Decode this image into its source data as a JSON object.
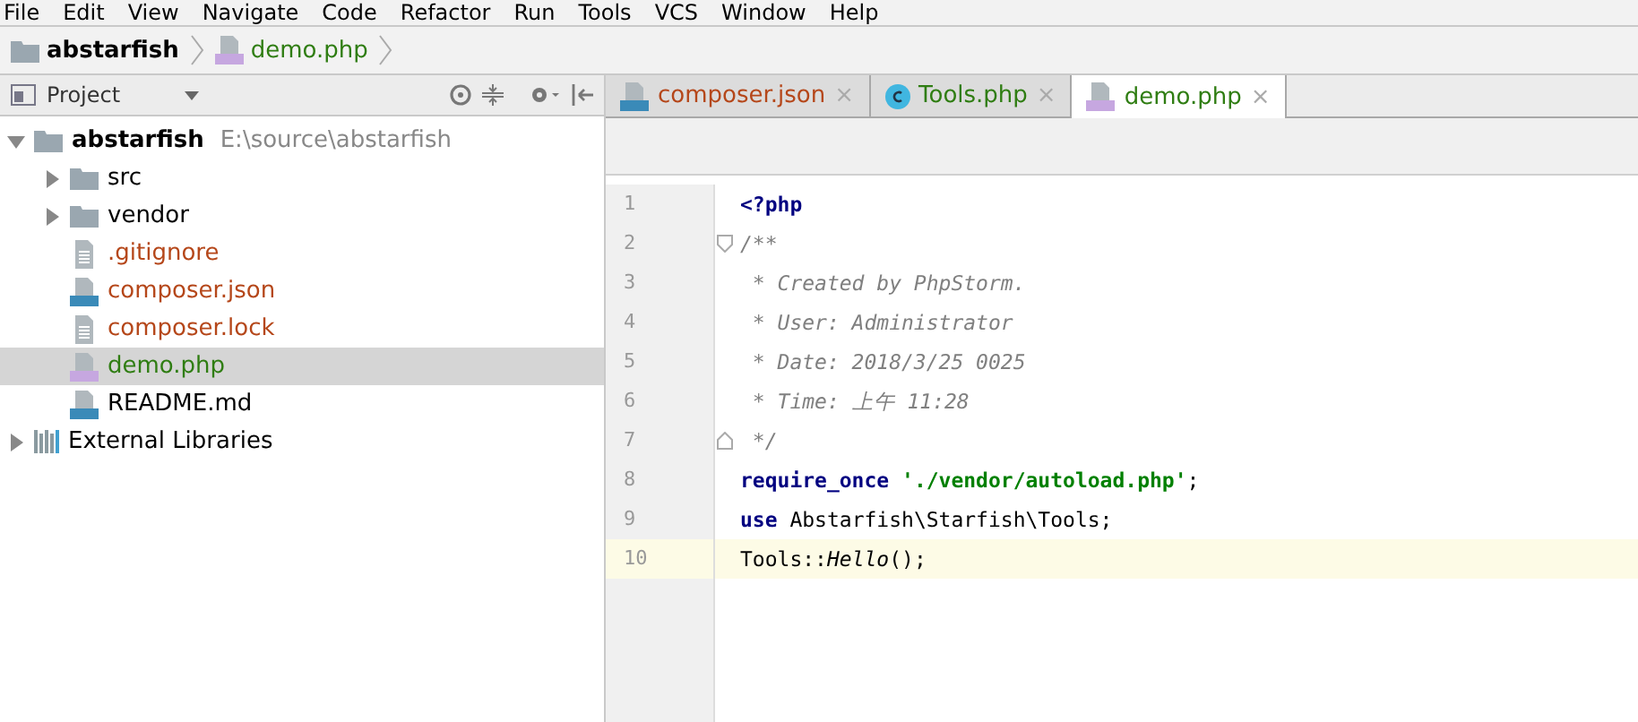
{
  "menu": [
    "File",
    "Edit",
    "View",
    "Navigate",
    "Code",
    "Refactor",
    "Run",
    "Tools",
    "VCS",
    "Window",
    "Help"
  ],
  "breadcrumb": [
    {
      "kind": "folder",
      "label": "abstarfish",
      "color": "#000000"
    },
    {
      "kind": "php",
      "label": "demo.php",
      "color": "#2f7d12"
    }
  ],
  "project_panel": {
    "title": "Project"
  },
  "tree": [
    {
      "kind": "folder",
      "label": "abstarfish",
      "hint": "E:\\source\\abstarfish",
      "expanded": true,
      "selected": false,
      "color": "#000000",
      "children": [
        {
          "kind": "folder",
          "label": "src",
          "expanded": false,
          "selected": false,
          "color": "#000000"
        },
        {
          "kind": "folder",
          "label": "vendor",
          "expanded": false,
          "selected": false,
          "color": "#000000"
        },
        {
          "kind": "text",
          "label": ".gitignore",
          "selected": false,
          "color": "#b5471a"
        },
        {
          "kind": "json",
          "label": "composer.json",
          "selected": false,
          "color": "#b5471a"
        },
        {
          "kind": "text",
          "label": "composer.lock",
          "selected": false,
          "color": "#b5471a"
        },
        {
          "kind": "php",
          "label": "demo.php",
          "selected": true,
          "color": "#2f7d12"
        },
        {
          "kind": "md",
          "label": "README.md",
          "selected": false,
          "color": "#000000"
        }
      ]
    },
    {
      "kind": "library",
      "label": "External Libraries",
      "expanded": false,
      "selected": false,
      "color": "#000000"
    }
  ],
  "tabs": [
    {
      "kind": "json",
      "label": "composer.json",
      "selected": false,
      "color": "#b5471a",
      "close": "×"
    },
    {
      "kind": "class",
      "label": "Tools.php",
      "selected": false,
      "color": "#2f7d12",
      "close": "×"
    },
    {
      "kind": "php",
      "label": "demo.php",
      "selected": true,
      "color": "#2f7d12",
      "close": "×"
    }
  ],
  "code": [
    {
      "number": "1",
      "current": false,
      "fold_start": false,
      "fold_end": false,
      "tokens": [
        {
          "kind": "keyword",
          "text": "<?php"
        }
      ]
    },
    {
      "number": "2",
      "current": false,
      "fold_start": true,
      "fold_end": false,
      "tokens": [
        {
          "kind": "comment",
          "text": "/**"
        }
      ]
    },
    {
      "number": "3",
      "current": false,
      "fold_start": false,
      "fold_end": false,
      "tokens": [
        {
          "kind": "comment",
          "text": " * Created by PhpStorm."
        }
      ]
    },
    {
      "number": "4",
      "current": false,
      "fold_start": false,
      "fold_end": false,
      "tokens": [
        {
          "kind": "comment",
          "text": " * User: Administrator"
        }
      ]
    },
    {
      "number": "5",
      "current": false,
      "fold_start": false,
      "fold_end": false,
      "tokens": [
        {
          "kind": "comment",
          "text": " * Date: 2018/3/25 0025"
        }
      ]
    },
    {
      "number": "6",
      "current": false,
      "fold_start": false,
      "fold_end": false,
      "tokens": [
        {
          "kind": "comment",
          "text": " * Time: 上午 11:28"
        }
      ]
    },
    {
      "number": "7",
      "current": false,
      "fold_start": false,
      "fold_end": true,
      "tokens": [
        {
          "kind": "comment",
          "text": " */"
        }
      ]
    },
    {
      "number": "8",
      "current": false,
      "fold_start": false,
      "fold_end": false,
      "tokens": [
        {
          "kind": "keyword",
          "text": "require_once "
        },
        {
          "kind": "string",
          "text": "'./vendor/autoload.php'"
        },
        {
          "kind": "plain",
          "text": ";"
        }
      ]
    },
    {
      "number": "9",
      "current": false,
      "fold_start": false,
      "fold_end": false,
      "tokens": [
        {
          "kind": "keyword",
          "text": "use"
        },
        {
          "kind": "plain",
          "text": " Abstarfish\\Starfish\\Tools;"
        }
      ]
    },
    {
      "number": "10",
      "current": true,
      "fold_start": false,
      "fold_end": false,
      "tokens": [
        {
          "kind": "plain",
          "text": "Tools::"
        },
        {
          "kind": "italic",
          "text": "Hello"
        },
        {
          "kind": "plain",
          "text": "();"
        }
      ]
    }
  ]
}
